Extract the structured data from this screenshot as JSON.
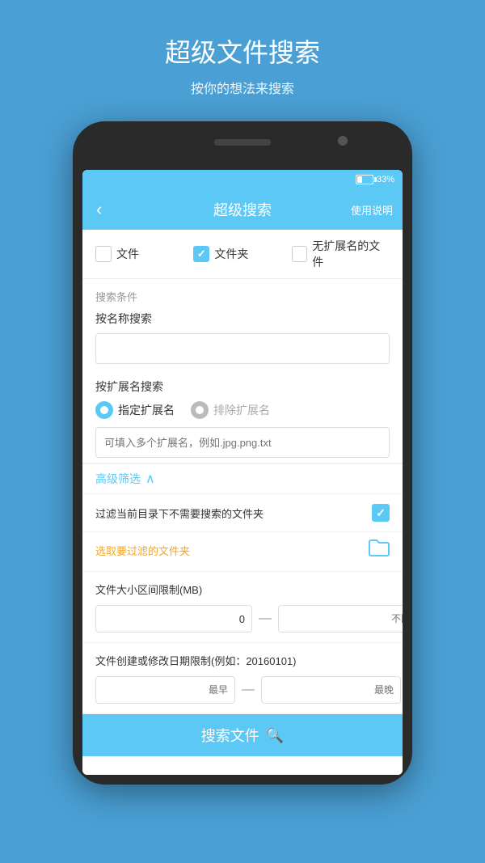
{
  "page": {
    "background_color": "#4a9fd4",
    "header": {
      "title": "超级文件搜索",
      "subtitle": "按你的想法来搜索"
    },
    "status_bar": {
      "battery_percent": "33%"
    },
    "app_bar": {
      "title": "超级搜索",
      "back_icon": "‹",
      "help_text": "使用说明"
    },
    "file_type_row": {
      "options": [
        {
          "label": "文件",
          "checked": false
        },
        {
          "label": "文件夹",
          "checked": true
        },
        {
          "label": "无扩展名的文件",
          "checked": false
        }
      ]
    },
    "search_conditions": {
      "section_label": "搜索条件",
      "name_search": {
        "label": "按名称搜索",
        "placeholder": ""
      },
      "ext_search": {
        "label": "按扩展名搜索",
        "radio_options": [
          {
            "label": "指定扩展名",
            "active": true
          },
          {
            "label": "排除扩展名",
            "active": false
          }
        ],
        "ext_placeholder": "可填入多个扩展名，例如.jpg.png.txt"
      }
    },
    "advanced_filter": {
      "label": "高级筛选",
      "chevron": "∧"
    },
    "filter_folder": {
      "text": "过滤当前目录下不需要搜索的文件夹",
      "checked": true,
      "select_text": "选取要过滤的文件夹",
      "folder_icon": "📁"
    },
    "file_size": {
      "label": "文件大小区间限制(MB)",
      "min_value": "0",
      "max_placeholder": "不限"
    },
    "file_date": {
      "label": "文件创建或修改日期限制(例如：20160101)",
      "earliest_placeholder": "最早",
      "latest_placeholder": "最晚"
    },
    "search_button": {
      "label": "搜索文件",
      "icon": "🔍"
    }
  }
}
